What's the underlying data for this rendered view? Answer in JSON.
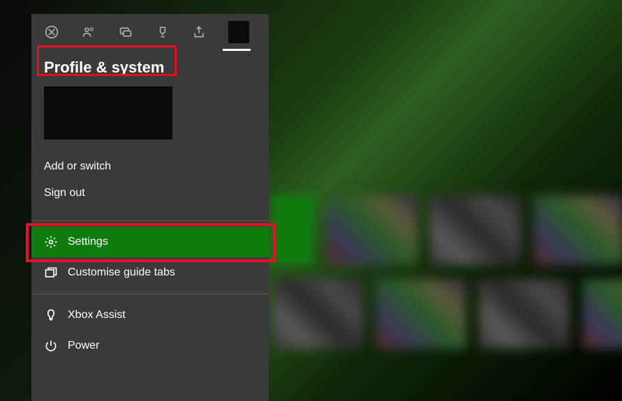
{
  "guide": {
    "title": "Profile & system",
    "tabs": [
      {
        "name": "xbox"
      },
      {
        "name": "people"
      },
      {
        "name": "chat"
      },
      {
        "name": "achievements"
      },
      {
        "name": "share"
      },
      {
        "name": "profile"
      }
    ],
    "account_menu": [
      {
        "label": "Add or switch"
      },
      {
        "label": "Sign out"
      }
    ],
    "system_menu": [
      {
        "icon": "gear",
        "label": "Settings",
        "selected": true
      },
      {
        "icon": "tabs",
        "label": "Customise guide tabs",
        "selected": false
      }
    ],
    "help_menu": [
      {
        "icon": "bulb",
        "label": "Xbox Assist"
      },
      {
        "icon": "power",
        "label": "Power"
      }
    ]
  },
  "colors": {
    "accent": "#107c10",
    "highlight": "#e81123",
    "panel": "#3a3a3a"
  }
}
